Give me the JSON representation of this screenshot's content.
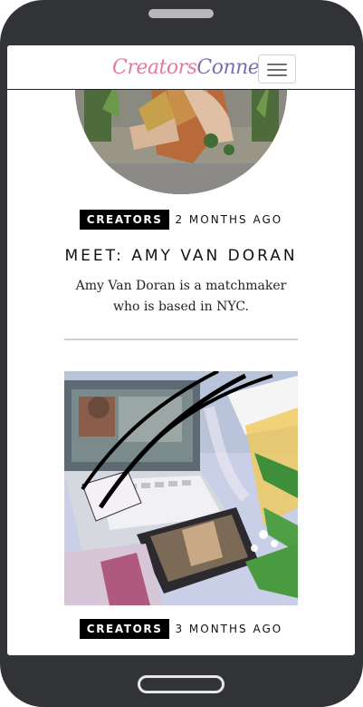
{
  "app": {
    "logo_text_part1": "Creators",
    "logo_text_part2": "Connect",
    "menu_button_aria": "Toggle navigation"
  },
  "articles": [
    {
      "category": "CREATORS",
      "time_ago": "2 MONTHS AGO",
      "title": "MEET: AMY VAN DORAN",
      "excerpt": "Amy Van Doran is a matchmaker who is based in NYC."
    },
    {
      "category": "CREATORS",
      "time_ago": "3 MONTHS AGO"
    }
  ],
  "colors": {
    "tag_bg": "#000000",
    "tag_text": "#ffffff",
    "phone_frame": "#323336",
    "divider": "#cfcfcf"
  }
}
